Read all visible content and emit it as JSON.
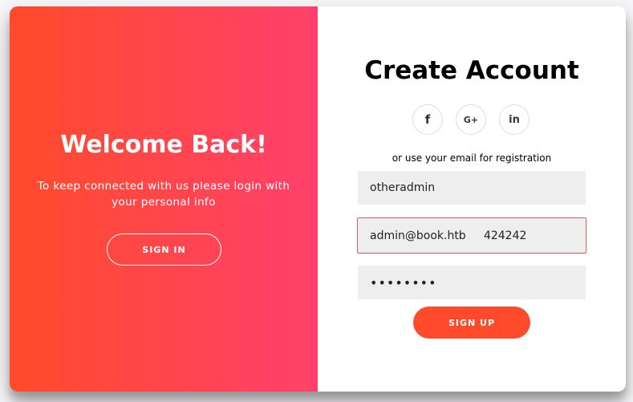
{
  "overlay": {
    "title": "Welcome Back!",
    "text": "To keep connected with us please login with your personal info",
    "signin_label": "SIGN IN"
  },
  "form": {
    "title": "Create Account",
    "social": [
      {
        "icon": "facebook-icon",
        "glyph": "f"
      },
      {
        "icon": "google-plus-icon",
        "glyph": "G+"
      },
      {
        "icon": "linkedin-icon",
        "glyph": "in"
      }
    ],
    "hint": "or use your email for registration",
    "name_value": "otheradmin",
    "email_value": "admin@book.htb     424242",
    "password_value": "••••••••",
    "signup_label": "SIGN UP"
  },
  "colors": {
    "accent": "#ff4b2b",
    "accent_end": "#ff416c",
    "field_bg": "#eeeeee",
    "error_border": "#e8585a"
  }
}
